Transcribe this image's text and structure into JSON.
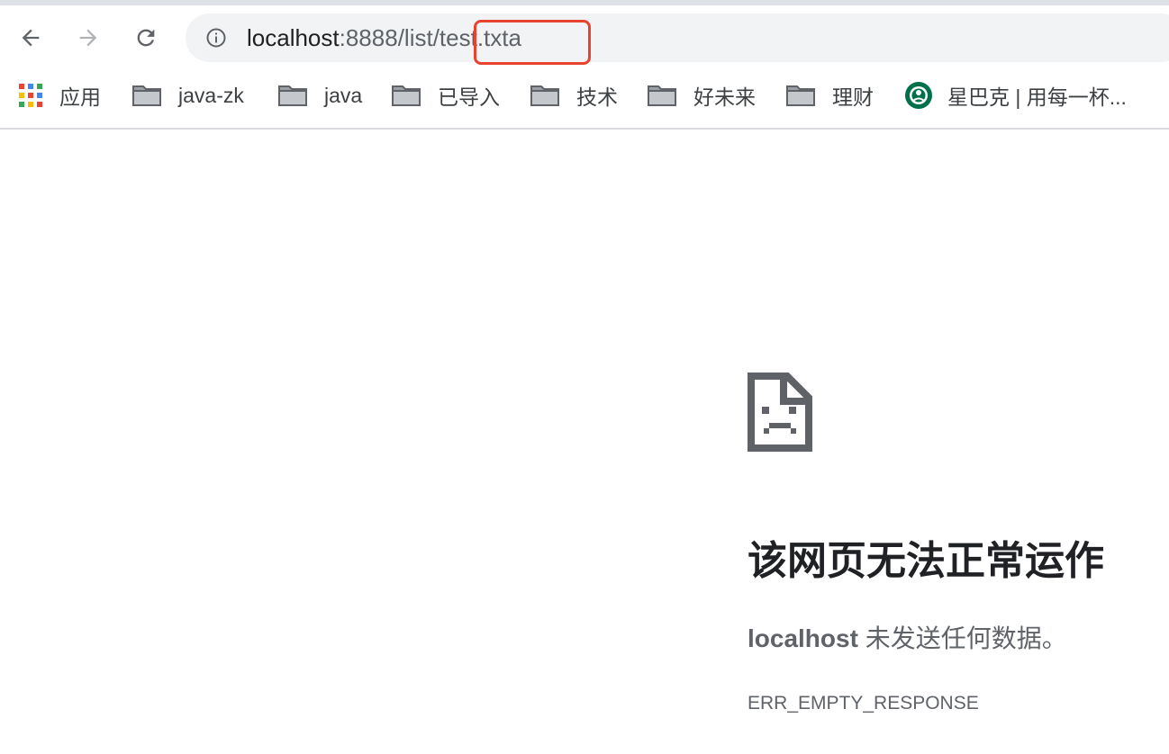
{
  "browser": {
    "url": {
      "host": "localhost",
      "port_path": ":8888/list/",
      "file": "test.txta"
    }
  },
  "bookmarks": [
    {
      "label": "应用",
      "icon": "apps-grid-icon"
    },
    {
      "label": "java-zk",
      "icon": "folder-icon"
    },
    {
      "label": "java",
      "icon": "folder-icon"
    },
    {
      "label": "已导入",
      "icon": "folder-icon"
    },
    {
      "label": "技术",
      "icon": "folder-icon"
    },
    {
      "label": "好未来",
      "icon": "folder-icon"
    },
    {
      "label": "理财",
      "icon": "folder-icon"
    },
    {
      "label": "星巴克 | 用每一杯...",
      "icon": "starbucks-logo-icon"
    }
  ],
  "error": {
    "title": "该网页无法正常运作",
    "host": "localhost",
    "message": " 未发送任何数据。",
    "code": "ERR_EMPTY_RESPONSE"
  },
  "colors": {
    "highlight": "#e8432f",
    "omnibox_bg": "#f1f3f4"
  }
}
